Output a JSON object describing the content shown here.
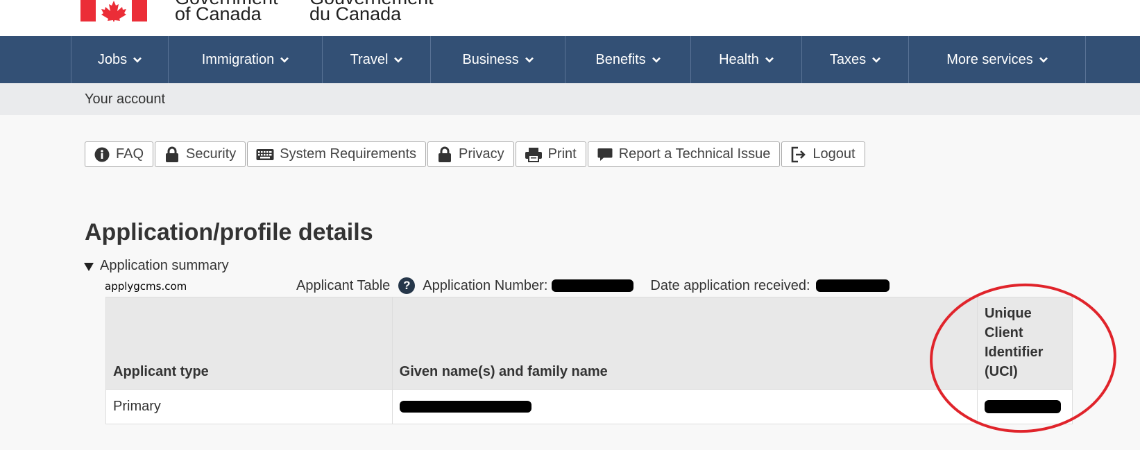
{
  "header": {
    "signature_en_top": "Government",
    "signature_en_bottom": "of Canada",
    "signature_fr_top": "Gouvernement",
    "signature_fr_bottom": "du Canada"
  },
  "nav": {
    "items": [
      {
        "label": "Jobs"
      },
      {
        "label": "Immigration"
      },
      {
        "label": "Travel"
      },
      {
        "label": "Business"
      },
      {
        "label": "Benefits"
      },
      {
        "label": "Health"
      },
      {
        "label": "Taxes"
      },
      {
        "label": "More services"
      }
    ]
  },
  "breadcrumb": {
    "label": "Your account"
  },
  "toolbar": {
    "faq": "FAQ",
    "security": "Security",
    "system_requirements": "System Requirements",
    "privacy": "Privacy",
    "print": "Print",
    "report_issue": "Report a Technical Issue",
    "logout": "Logout"
  },
  "page": {
    "title": "Application/profile details",
    "summary_label": "Application summary",
    "watermark": "applygcms.com"
  },
  "caption": {
    "table_label": "Applicant Table",
    "help_symbol": "?",
    "application_number_label": "Application Number:",
    "date_received_label": "Date application received:"
  },
  "table": {
    "headers": [
      "Applicant type",
      "Given name(s) and family name",
      "Unique Client Identifier (UCI)"
    ],
    "rows": [
      {
        "applicant_type": "Primary"
      }
    ]
  },
  "colors": {
    "nav_bg": "#335075",
    "flag_red": "#eb2d37",
    "annotation_circle": "#e0242b",
    "help_icon": "#26374a"
  }
}
